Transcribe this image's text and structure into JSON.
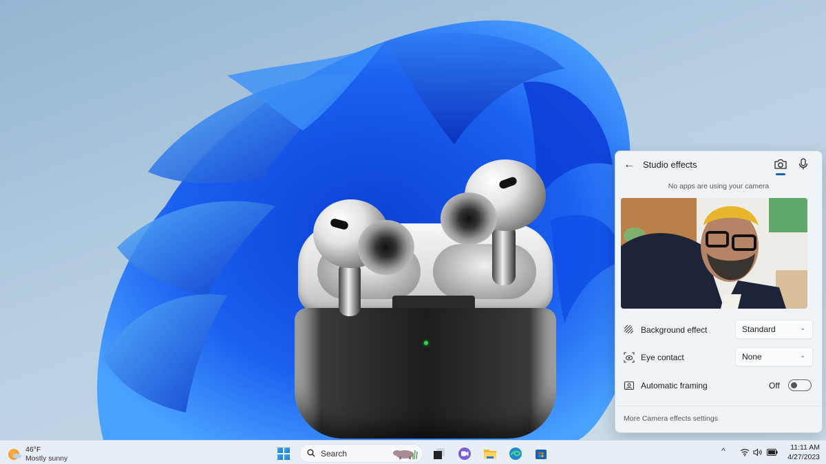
{
  "wallpaper": {
    "name": "Windows 11 Bloom"
  },
  "product_image": {
    "name": "AirPods Pro case",
    "led_color": "#2bd64b"
  },
  "studio_effects": {
    "back_label": "←",
    "title": "Studio effects",
    "tabs": [
      {
        "name": "camera",
        "icon": "camera-icon",
        "selected": true
      },
      {
        "name": "microphone",
        "icon": "microphone-icon",
        "selected": false
      }
    ],
    "status": "No apps are using your camera",
    "preview_alt": "Camera preview",
    "settings": [
      {
        "label": "Background effect",
        "icon": "background-effect-icon",
        "type": "dropdown",
        "value": "Standard"
      },
      {
        "label": "Eye contact",
        "icon": "eye-contact-icon",
        "type": "dropdown",
        "value": "None"
      },
      {
        "label": "Automatic framing",
        "icon": "framing-icon",
        "type": "toggle",
        "value": "Off",
        "on": false
      }
    ],
    "more_link": "More Camera effects settings",
    "accent_color": "#1f5fb0"
  },
  "taskbar": {
    "weather": {
      "temp": "46°F",
      "condition": "Mostly sunny"
    },
    "search_placeholder": "Search",
    "apps": [
      "start",
      "search",
      "task-view",
      "teams-chat",
      "file-explorer",
      "edge",
      "microsoft-store"
    ],
    "tray": {
      "chevron": "^",
      "clock_time": "11:11 AM",
      "clock_date": "4/27/2023"
    }
  }
}
